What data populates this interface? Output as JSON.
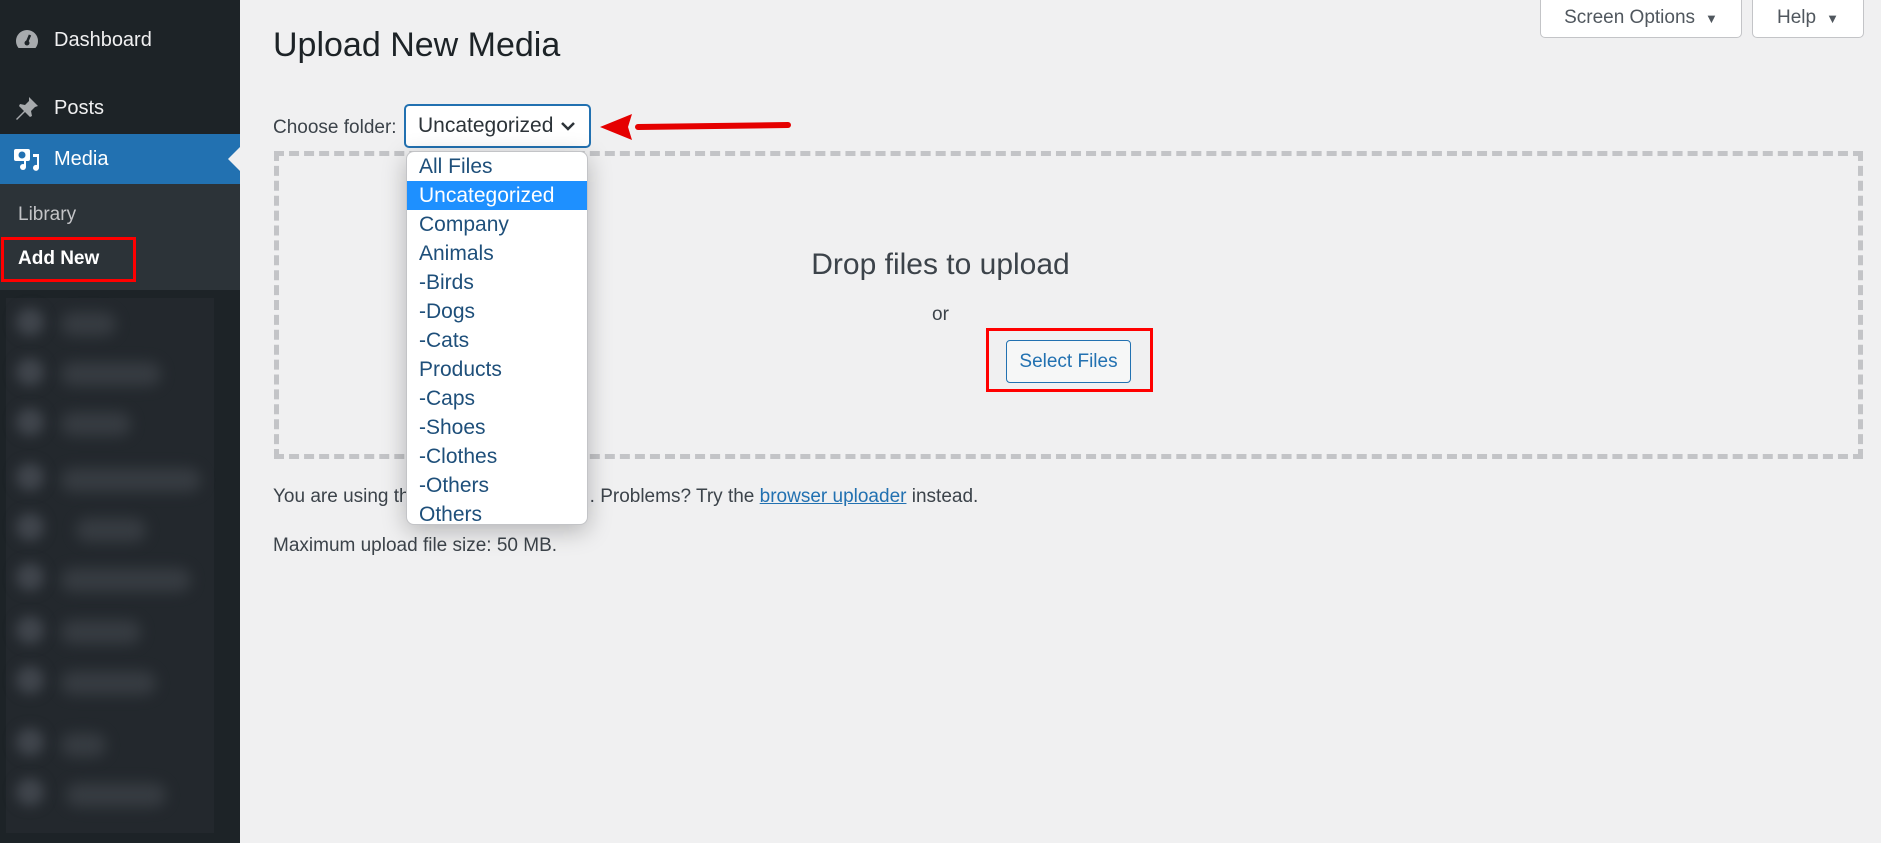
{
  "sidebar": {
    "items": [
      {
        "label": "Dashboard",
        "icon": "dashboard-icon"
      },
      {
        "label": "Posts",
        "icon": "pin-icon"
      },
      {
        "label": "Media",
        "icon": "media-icon",
        "active": true
      }
    ],
    "submenu": [
      {
        "label": "Library"
      },
      {
        "label": "Add New",
        "current": true
      }
    ]
  },
  "header": {
    "title": "Upload New Media",
    "screen_options": "Screen Options",
    "help": "Help",
    "caret": "▼"
  },
  "folder": {
    "label": "Choose folder:",
    "selected": "Uncategorized",
    "options": [
      "All Files",
      "Uncategorized",
      "Company",
      "Animals",
      "-Birds",
      "-Dogs",
      "-Cats",
      "Products",
      "-Caps",
      "-Shoes",
      "-Clothes",
      "-Others",
      "Others"
    ],
    "selected_index": 1
  },
  "upload": {
    "drop_text": "Drop files to upload",
    "or_text": "or",
    "select_files": "Select Files"
  },
  "info": {
    "line1_prefix": "You are using th",
    "line1_middle": ". Problems? Try the ",
    "link": "browser uploader",
    "line1_suffix": " instead.",
    "max_size": "Maximum upload file size: 50 MB."
  },
  "colors": {
    "accent": "#2271b1",
    "sidebar_bg": "#1d2327",
    "highlight": "#ff0000",
    "selected_option": "#1e90ff"
  }
}
